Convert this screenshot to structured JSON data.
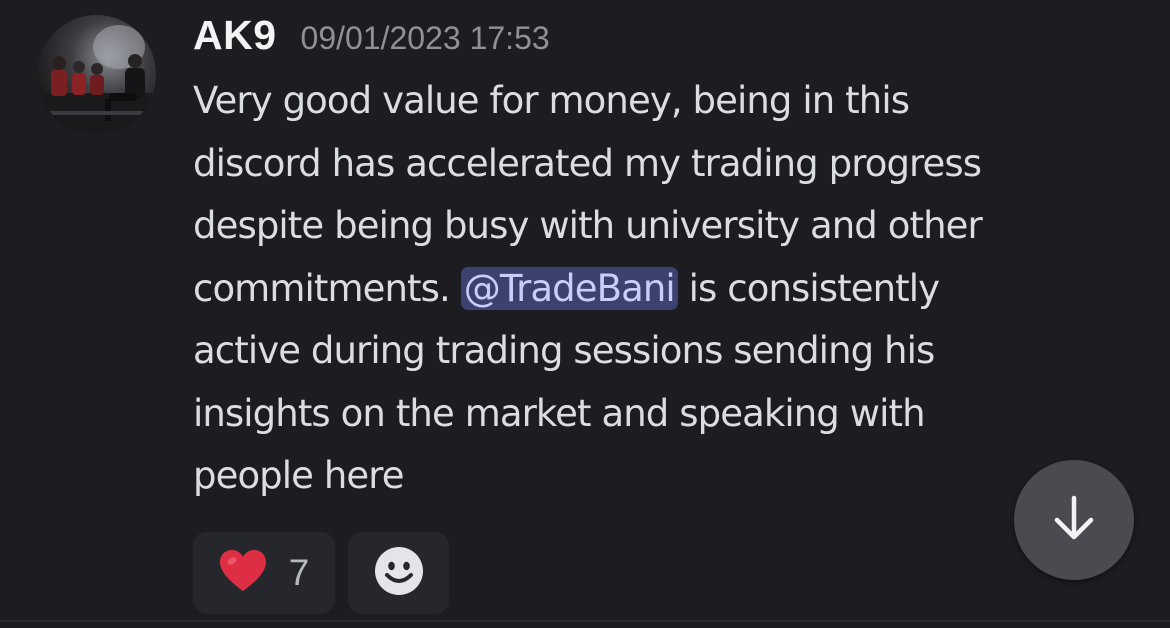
{
  "message": {
    "author": "AK9",
    "timestamp": "09/01/2023 17:53",
    "avatar_icon": "user-avatar-photo",
    "content_lines": [
      {
        "text": "Very good value for money, being in this"
      },
      {
        "text": "discord has accelerated my trading progress"
      },
      {
        "text": "despite being busy with university and other"
      },
      {
        "before": "commitments. ",
        "mention": "@TradeBani",
        "after": " is consistently"
      },
      {
        "text": "active during trading sessions sending his"
      },
      {
        "text": "insights on the market and speaking with"
      },
      {
        "text": "people here"
      }
    ],
    "reactions": [
      {
        "emoji_icon": "red-heart-emoji",
        "count": "7"
      }
    ],
    "add_reaction_icon": "smiley-face-icon"
  },
  "jump_button_icon": "arrow-down-icon",
  "colors": {
    "background": "#1c1c21",
    "mention_bg": "#3c4270",
    "mention_text": "#c9cdfb",
    "heart": "#dd2e44"
  }
}
